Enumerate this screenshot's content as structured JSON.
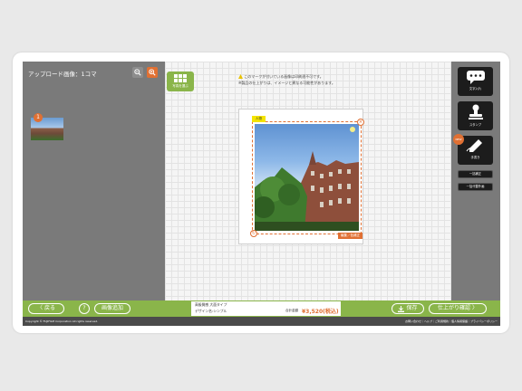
{
  "left_panel": {
    "title": "アップロード画像：1コマ",
    "thumbnail_badge": "1"
  },
  "center": {
    "layout_button_label": "写真を選ぶ",
    "notice_line1": "このマークが付いている画像は印刷適不可です。",
    "notice_line2": "※製品の仕上がりは、イメージと異なる可能性があります。",
    "photo_tag": "人物",
    "edit_tag": "編集／色補正"
  },
  "right_panel": {
    "tools": [
      {
        "label": "文字入れ"
      },
      {
        "label": "スタンプ"
      },
      {
        "label": "手書き"
      }
    ],
    "new_badge": "NEW",
    "small_buttons": [
      {
        "label": "一括補正"
      },
      {
        "label": "一括代替外画"
      }
    ]
  },
  "bottom_bar": {
    "back_label": "戻る",
    "help_label": "?",
    "add_image_label": "画像追加",
    "save_label": "保存",
    "confirm_label": "仕上がり確認",
    "product_line1": "高級質感 大面タイプ",
    "product_line2": "デザイン名:シンプル",
    "total_label": "合計金額",
    "price": "¥3,520(税込)"
  },
  "footer": {
    "copyright": "Copyright © FUJIFILM Corporation All rights reserved.",
    "links": "お問い合わせ｜ヘルプ｜ご利用規約｜個人情報保護｜プライバシーポリシー"
  },
  "colors": {
    "accent_green": "#8ab54a",
    "accent_orange": "#e07033",
    "panel_gray": "#7a7a7a",
    "tool_black": "#1c1c1c"
  }
}
